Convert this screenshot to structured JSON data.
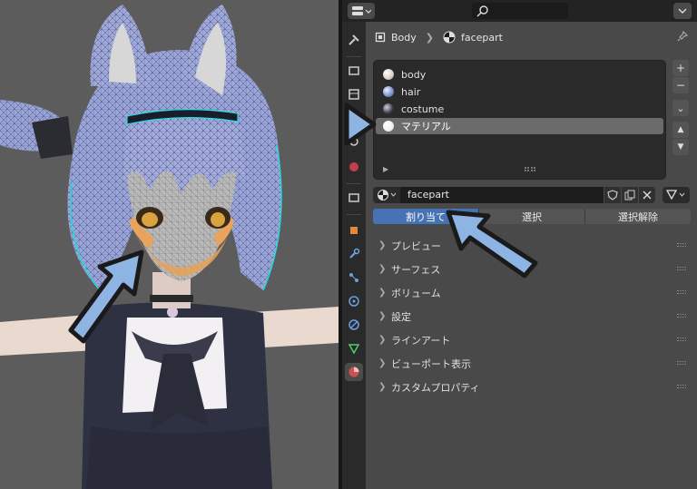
{
  "breadcrumb": {
    "object": "Body",
    "material": "facepart"
  },
  "material_slots": [
    {
      "name": "body",
      "color": "#d9cfc6"
    },
    {
      "name": "hair",
      "color": "#7c90c8"
    },
    {
      "name": "costume",
      "color": "#3a3a46"
    },
    {
      "name": "マテリアル",
      "color": "#f2f2f2",
      "selected": true
    }
  ],
  "material_field": {
    "name": "facepart"
  },
  "assign_buttons": {
    "assign": "割り当て",
    "select": "選択",
    "deselect": "選択解除"
  },
  "panels": [
    "プレビュー",
    "サーフェス",
    "ボリューム",
    "設定",
    "ラインアート",
    "ビューポート表示",
    "カスタムプロパティ"
  ],
  "side_buttons": {
    "add": "+",
    "remove": "−",
    "menu": "⌄",
    "up": "▲",
    "down": "▼"
  },
  "colors": {
    "accent": "#4772b3",
    "arrow_fill": "#8eb4e3",
    "arrow_stroke": "#1a1a1a"
  }
}
